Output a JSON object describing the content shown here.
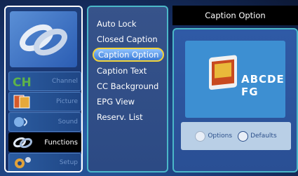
{
  "sidebar": {
    "items": [
      {
        "label": "Channel",
        "icon": "channel-icon"
      },
      {
        "label": "Picture",
        "icon": "picture-icon"
      },
      {
        "label": "Sound",
        "icon": "sound-icon"
      },
      {
        "label": "Functions",
        "icon": "functions-icon"
      },
      {
        "label": "Setup",
        "icon": "setup-icon"
      }
    ]
  },
  "menu": {
    "items": [
      {
        "label": "Auto Lock"
      },
      {
        "label": "Closed Caption"
      },
      {
        "label": "Caption Option"
      },
      {
        "label": "Caption Text"
      },
      {
        "label": "CC Background"
      },
      {
        "label": "EPG View"
      },
      {
        "label": "Reserv. List"
      }
    ]
  },
  "panel": {
    "title": "Caption Option",
    "preview_text": "ABCDE FG",
    "options_label": "Options",
    "defaults_label": "Defaults"
  },
  "colors": {
    "accent_border": "#4bb8c8",
    "selected_outline": "#f2d33a",
    "title_bg": "#000000"
  }
}
